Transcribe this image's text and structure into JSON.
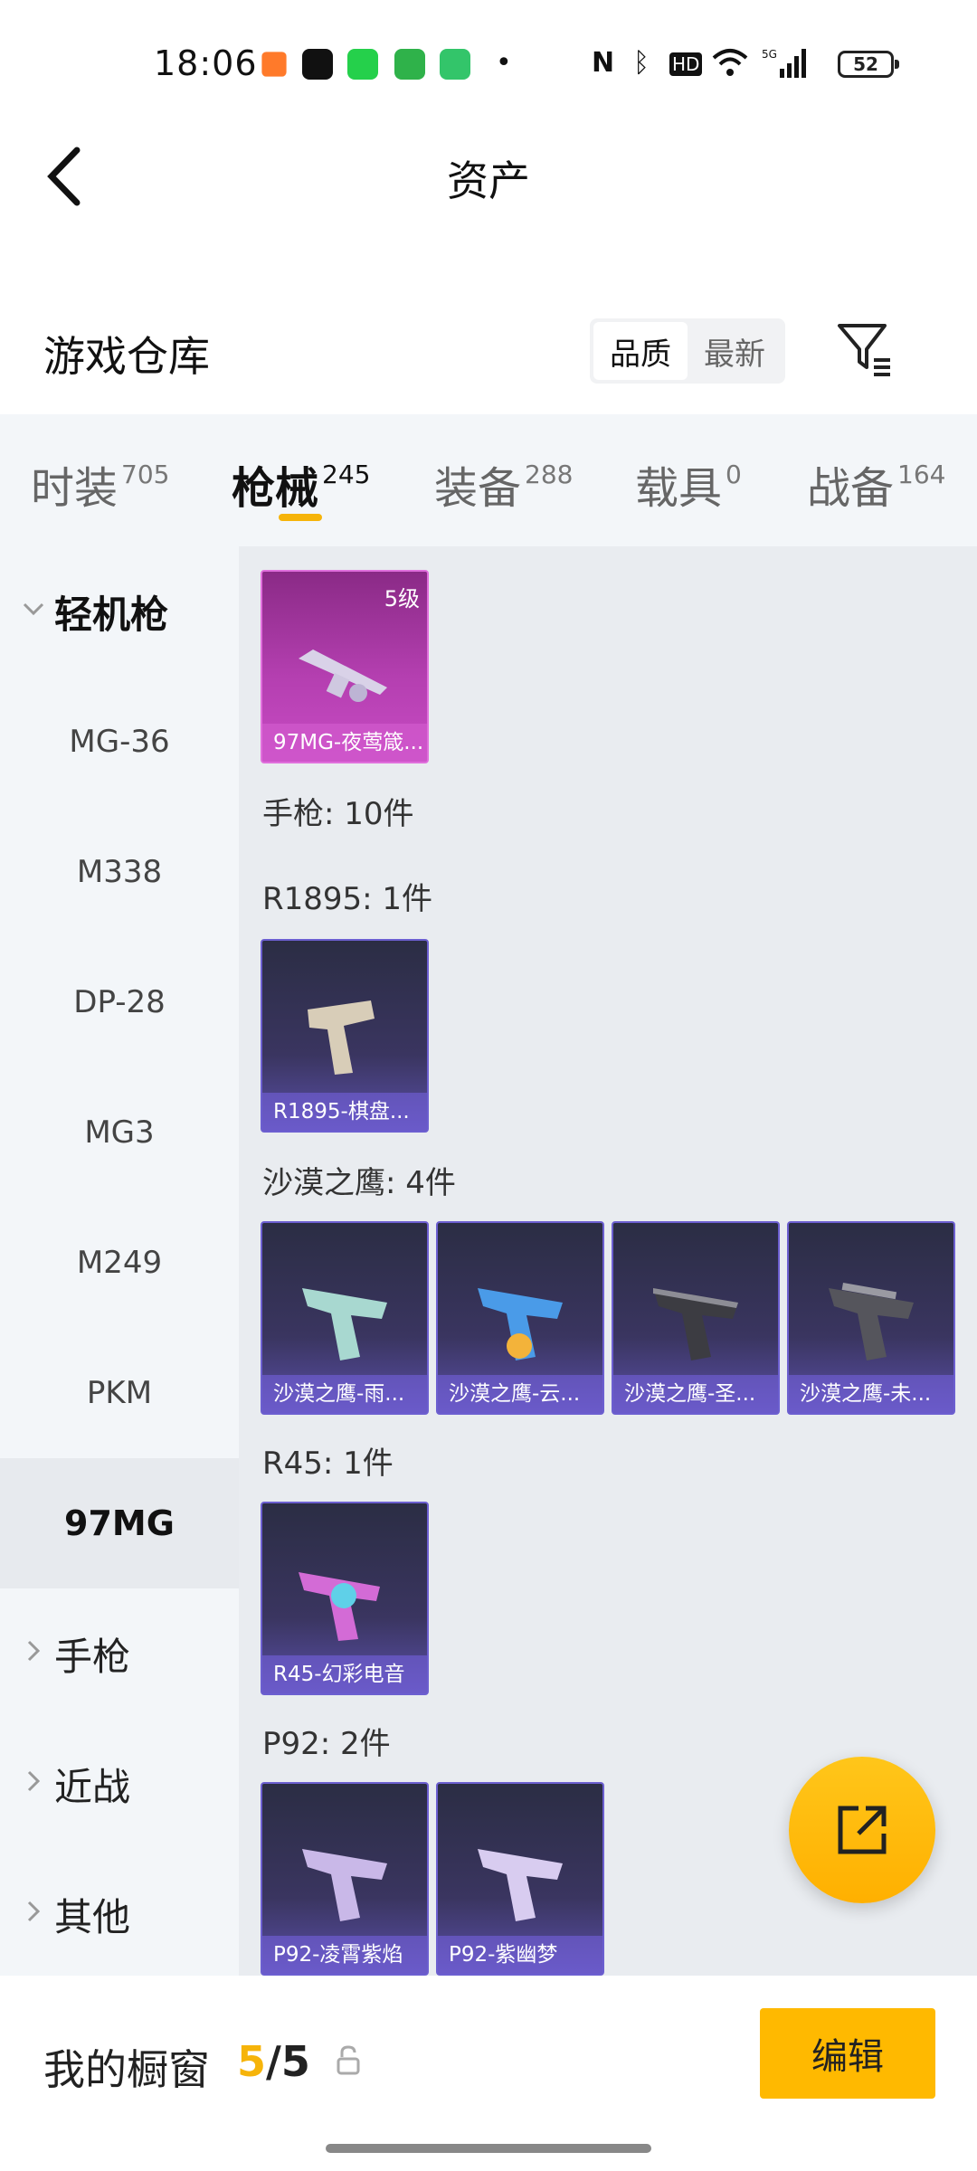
{
  "status_bar": {
    "time": "18:06",
    "battery": "52",
    "icons": [
      "game-app-icon",
      "tiktok-icon",
      "wechat-mini-icon",
      "app-icon",
      "shield-app-icon",
      "dot-icon",
      "nfc-icon",
      "bluetooth-icon",
      "hd-icon",
      "wifi-icon",
      "signal-5g-icon",
      "battery-icon"
    ]
  },
  "header": {
    "title": "资产"
  },
  "warehouse": {
    "title": "游戏仓库",
    "sort_options": [
      "品质",
      "最新"
    ],
    "active_sort": "品质"
  },
  "tabs": [
    {
      "label": "时装",
      "count": "705"
    },
    {
      "label": "枪械",
      "count": "245",
      "active": true
    },
    {
      "label": "装备",
      "count": "288"
    },
    {
      "label": "载具",
      "count": "0"
    },
    {
      "label": "战备",
      "count": "164"
    }
  ],
  "sidebar": {
    "group_lmg": "轻机枪",
    "items": [
      "MG-36",
      "M338",
      "DP-28",
      "MG3",
      "M249",
      "PKM",
      "97MG"
    ],
    "active_item": "97MG",
    "groups": [
      "手枪",
      "近战",
      "其他"
    ]
  },
  "content": {
    "top_card": {
      "name": "97MG-夜莺箴...",
      "level": "5级"
    },
    "pistol_total": "手枪: 10件",
    "sections": [
      {
        "label": "R1895: 1件",
        "cards": [
          "R1895-棋盘..."
        ]
      },
      {
        "label": "沙漠之鹰: 4件",
        "cards": [
          "沙漠之鹰-雨...",
          "沙漠之鹰-云...",
          "沙漠之鹰-圣...",
          "沙漠之鹰-未..."
        ]
      },
      {
        "label": "R45: 1件",
        "cards": [
          "R45-幻彩电音"
        ]
      },
      {
        "label": "P92: 2件",
        "cards": [
          "P92-凌霄紫焰",
          "P92-紫幽梦"
        ]
      }
    ]
  },
  "bottom_bar": {
    "label": "我的橱窗",
    "count_current": "5",
    "count_total": "/5",
    "edit_label": "编辑"
  },
  "colors": {
    "accent": "#ffb900",
    "underline": "#f6b40a",
    "card_blue": "#3a3560",
    "card_purple": "#b43fb0"
  }
}
